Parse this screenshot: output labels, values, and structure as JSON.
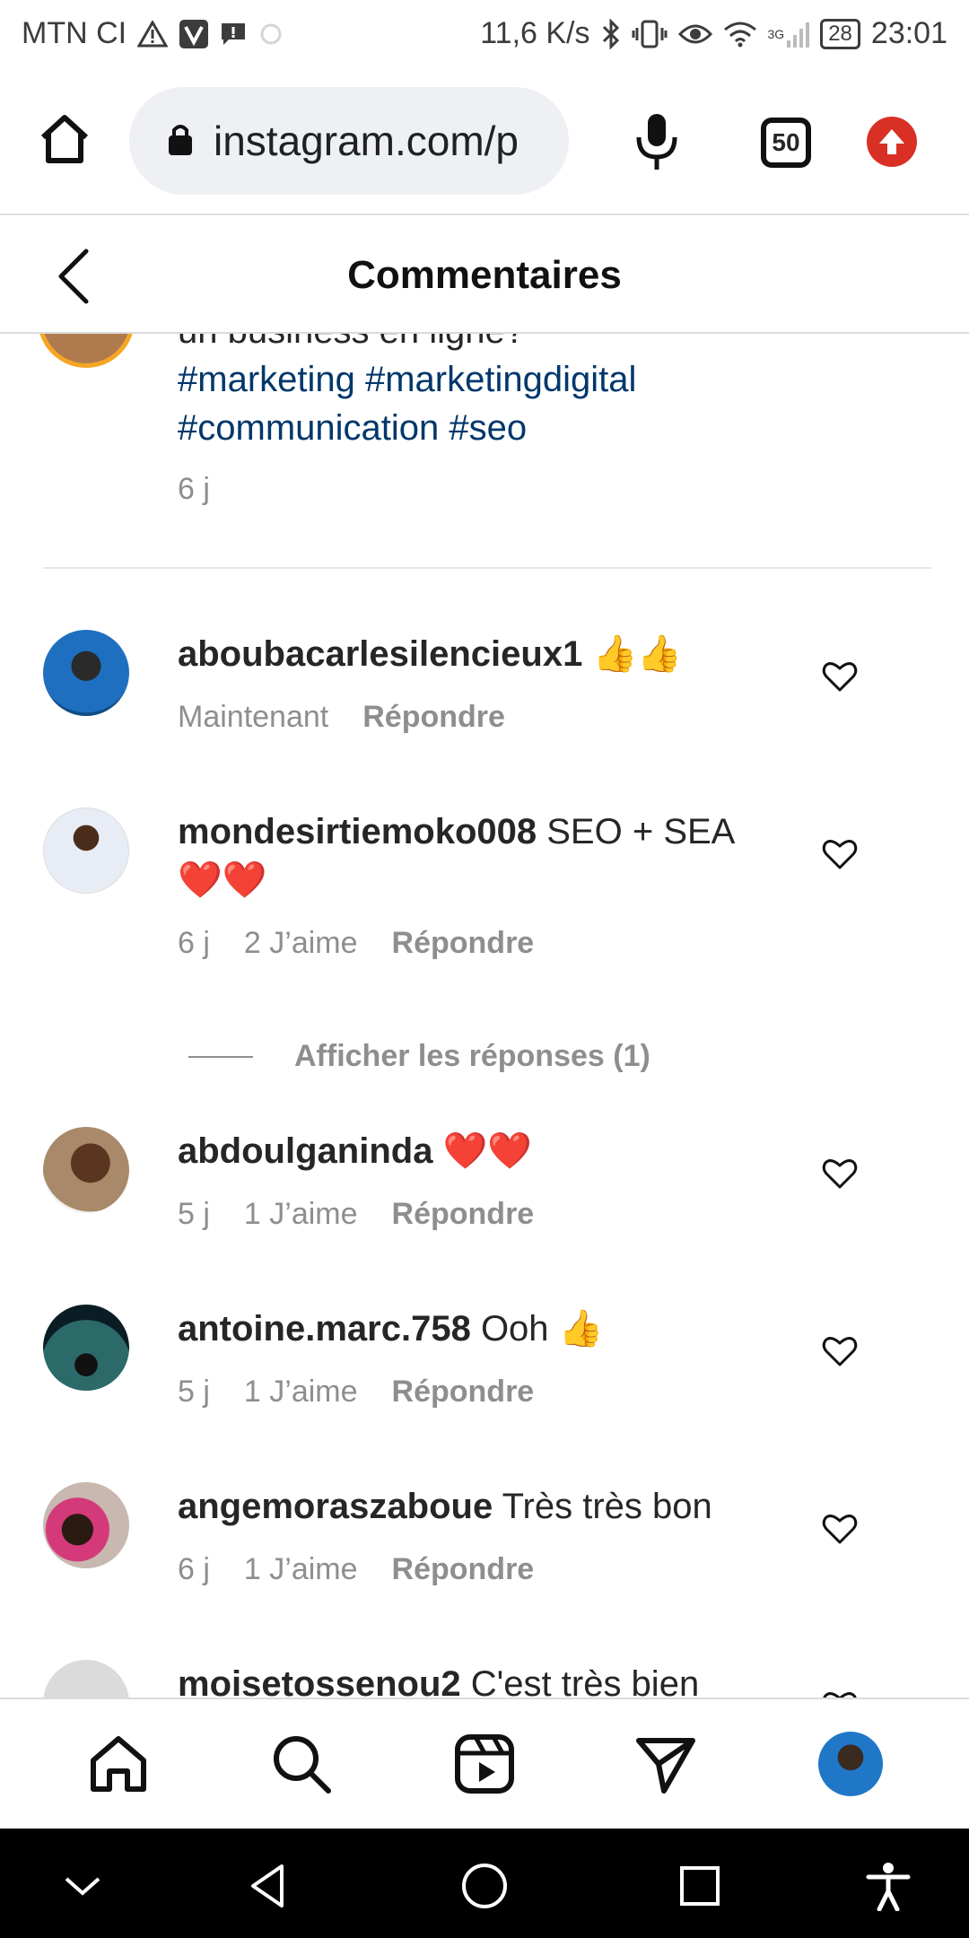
{
  "status_bar": {
    "carrier": "MTN CI",
    "speed": "11,6 K/s",
    "network": "3G",
    "battery": "28",
    "time": "23:01"
  },
  "browser": {
    "url": "instagram.com/p",
    "tabs_count": "50"
  },
  "header": {
    "title": "Commentaires"
  },
  "caption": {
    "text": "un business en ligne?",
    "tags_line1": "#marketing #marketingdigital",
    "tags_line2": "#communication #seo",
    "time": "6 j"
  },
  "comments": [
    {
      "user": "aboubacarlesilencieux1",
      "text": " 👍👍",
      "time": "Maintenant",
      "likes": "",
      "reply": "Répondre"
    },
    {
      "user": "mondesirtiemoko008",
      "text": " SEO + SEA ❤️❤️",
      "time": "6 j",
      "likes": "2 J’aime",
      "reply": "Répondre"
    },
    {
      "user": "abdoulganinda",
      "text": " ❤️❤️",
      "time": "5 j",
      "likes": "1 J’aime",
      "reply": "Répondre"
    },
    {
      "user": "antoine.marc.758",
      "text": " Ooh 👍",
      "time": "5 j",
      "likes": "1 J’aime",
      "reply": "Répondre"
    },
    {
      "user": "angemoraszaboue",
      "text": " Très très bon",
      "time": "6 j",
      "likes": "1 J’aime",
      "reply": "Répondre"
    },
    {
      "user": "moisetossenou2",
      "text": " C'est très bien",
      "time": "",
      "likes": "",
      "reply": ""
    }
  ],
  "show_replies": "Afficher les réponses (1)",
  "icons": {
    "home": "home-icon",
    "search": "search-icon",
    "reels": "reels-icon",
    "direct": "direct-message-icon",
    "heart": "heart-icon"
  }
}
